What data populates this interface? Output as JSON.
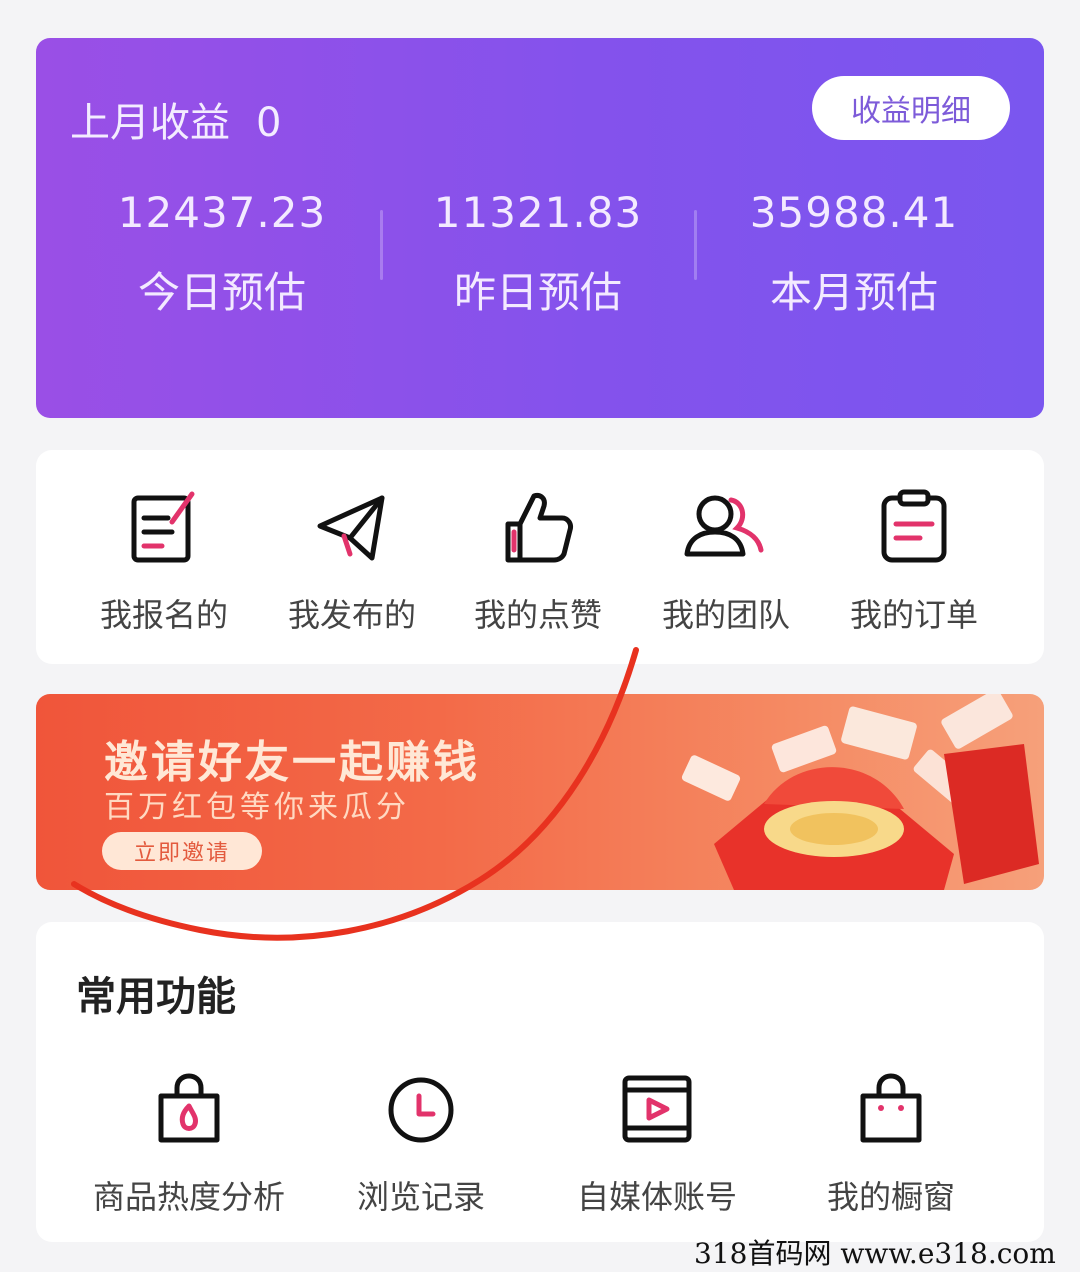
{
  "earnings": {
    "title": "上月收益",
    "last_month_value": "0",
    "detail_button": "收益明细",
    "stats": [
      {
        "value": "12437.23",
        "label": "今日预估"
      },
      {
        "value": "11321.83",
        "label": "昨日预估"
      },
      {
        "value": "35988.41",
        "label": "本月预估"
      }
    ]
  },
  "quick_menu": [
    {
      "label": "我报名的",
      "icon": "edit-document-icon"
    },
    {
      "label": "我发布的",
      "icon": "paper-plane-icon"
    },
    {
      "label": "我的点赞",
      "icon": "thumbs-up-icon"
    },
    {
      "label": "我的团队",
      "icon": "team-icon"
    },
    {
      "label": "我的订单",
      "icon": "clipboard-icon"
    }
  ],
  "banner": {
    "title": "邀请好友一起赚钱",
    "subtitle": "百万红包等你来瓜分",
    "button": "立即邀请"
  },
  "common": {
    "title": "常用功能",
    "items": [
      {
        "label": "商品热度分析",
        "icon": "shopping-bag-fire-icon"
      },
      {
        "label": "浏览记录",
        "icon": "clock-icon"
      },
      {
        "label": "自媒体账号",
        "icon": "video-player-icon"
      },
      {
        "label": "我的橱窗",
        "icon": "shop-bag-icon"
      }
    ]
  },
  "watermark": "318首码网  www.e318.com",
  "colors": {
    "card_purple_start": "#9a4fe6",
    "card_purple_end": "#7a56ef",
    "banner_red": "#f0553a",
    "accent_pink": "#e2336b",
    "scribble_red": "#e8321f"
  }
}
